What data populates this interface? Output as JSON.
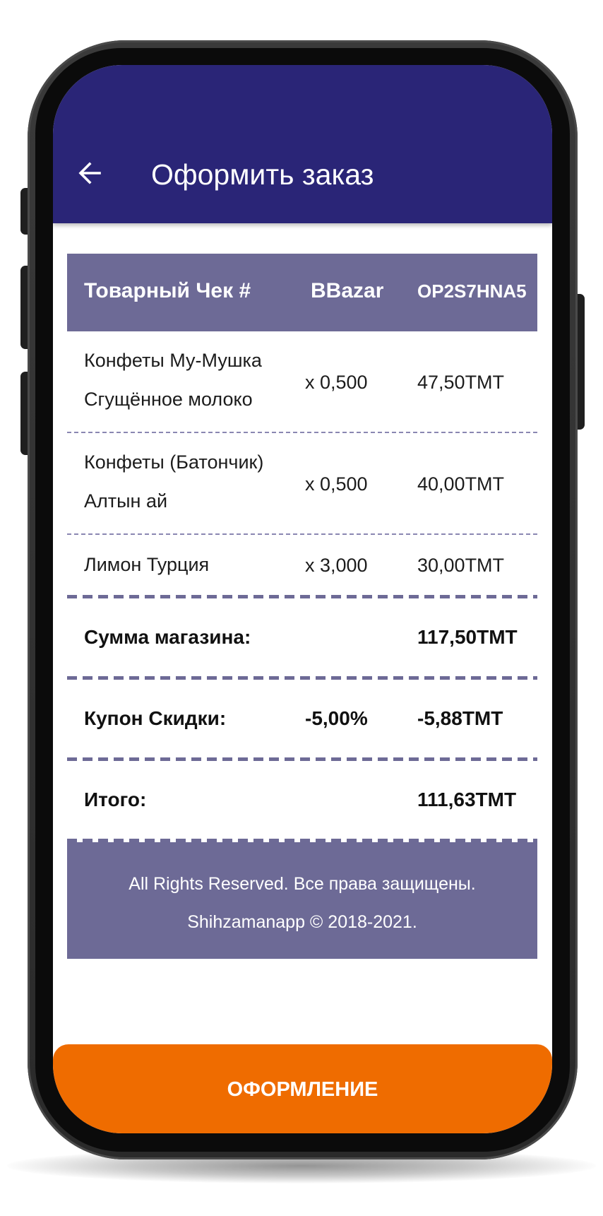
{
  "appbar": {
    "title": "Оформить заказ",
    "back_icon": "arrow-left-icon",
    "background": "#2a2577"
  },
  "receipt": {
    "header": {
      "label": "Товарный Чек #",
      "store": "BBazar",
      "code": "OP2S7HNA5"
    },
    "items": [
      {
        "name_line1": "Конфеты Му-Мушка",
        "name_line2": "Сгущённое молоко",
        "qty": "x 0,500",
        "price": "47,50TMT"
      },
      {
        "name_line1": "Конфеты (Батончик)",
        "name_line2": "Алтын ай",
        "qty": "x 0,500",
        "price": "40,00TMT"
      },
      {
        "name_line1": "Лимон Турция",
        "qty": "x 3,000",
        "price": "30,00TMT"
      }
    ],
    "store_sum": {
      "label": "Сумма магазина:",
      "value": "117,50TMT"
    },
    "coupon": {
      "label": "Купон Скидки:",
      "percent": "-5,00%",
      "value": "-5,88TMT"
    },
    "total": {
      "label": "Итого:",
      "value": "111,63TMT"
    },
    "footer": {
      "line1": "All Rights Reserved. Все права защищены.",
      "line2": "Shihzamanapp © 2018-2021."
    },
    "accent_color": "#6d6a96"
  },
  "checkout_button": {
    "label": "ОФОРМЛЕНИЕ",
    "color": "#ef6c00"
  }
}
